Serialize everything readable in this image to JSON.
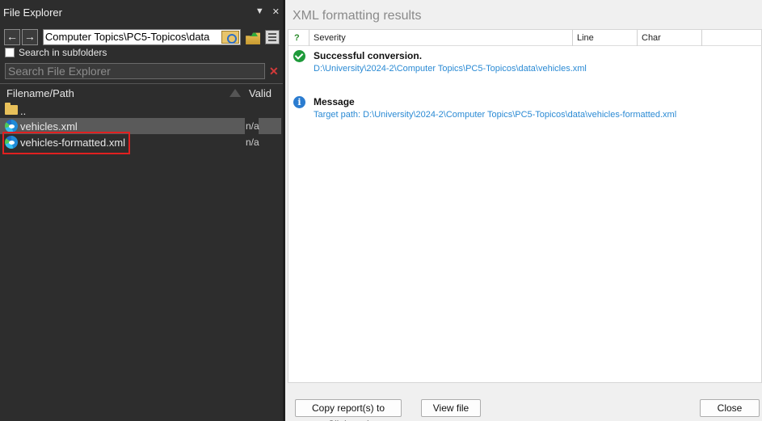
{
  "explorer": {
    "title": "File Explorer",
    "pin_glyph": "▼",
    "close_glyph": "✕",
    "back_glyph": "←",
    "forward_glyph": "→",
    "path": "Computer Topics\\PC5-Topicos\\data",
    "search_subfolders_label": "Search in subfolders",
    "search_placeholder": "Search File Explorer",
    "clear_search_glyph": "✕",
    "columns": {
      "name": "Filename/Path",
      "valid": "Valid"
    },
    "items": [
      {
        "name": "..",
        "valid": "",
        "icon": "folder-icon"
      },
      {
        "name": "vehicles.xml",
        "valid": "n/a",
        "icon": "edge-icon"
      },
      {
        "name": "vehicles-formatted.xml",
        "valid": "n/a",
        "icon": "edge-icon"
      }
    ]
  },
  "results": {
    "title": "XML formatting results",
    "columns": {
      "status": "?",
      "severity": "Severity",
      "line": "Line",
      "char": "Char"
    },
    "entries": [
      {
        "type": "success",
        "icon_glyph": "",
        "title": "Successful conversion.",
        "detail": "D:\\University\\2024-2\\Computer Topics\\PC5-Topicos\\data\\vehicles.xml"
      },
      {
        "type": "info",
        "icon_glyph": "i",
        "title": "Message",
        "detail": "Target path: D:\\University\\2024-2\\Computer Topics\\PC5-Topicos\\data\\vehicles-formatted.xml"
      }
    ],
    "buttons": {
      "copy": "Copy report(s) to Clipboard",
      "view": "View file",
      "close": "Close"
    }
  },
  "colors": {
    "explorer_bg": "#2d2d2d",
    "selection": "#5a5a5a",
    "highlight": "#e02020",
    "link_blue": "#2a8ad4",
    "success_green": "#1e9a3a",
    "info_blue": "#2b7cd0"
  }
}
